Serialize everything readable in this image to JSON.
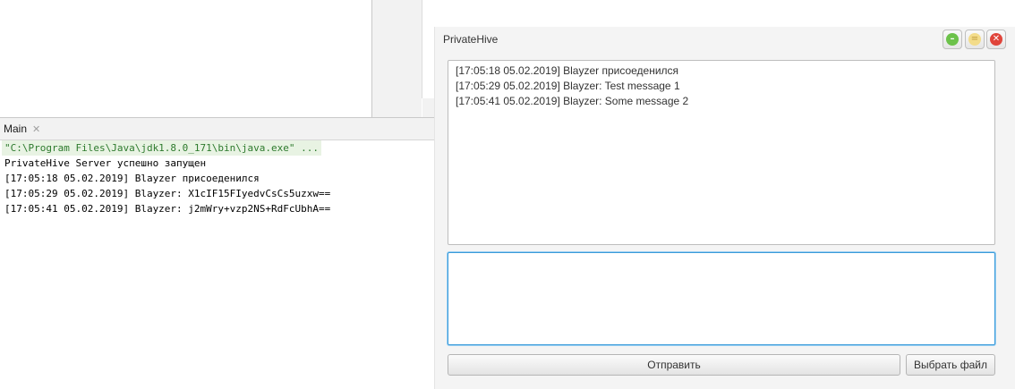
{
  "ide": {
    "run_tab": {
      "label": "Main",
      "close_icon": "close-icon"
    },
    "console": {
      "lines": [
        "\"C:\\Program Files\\Java\\jdk1.8.0_171\\bin\\java.exe\" ...",
        "PrivateHive Server успешно запущен",
        "[17:05:18 05.02.2019] Blayzer присоеденился",
        "[17:05:29 05.02.2019] Blayzer: X1cIF15FIyedvCsCs5uzxw==",
        "[17:05:41 05.02.2019] Blayzer: j2mWry+vzp2NS+RdFcUbhA=="
      ]
    }
  },
  "window": {
    "title": "PrivateHive",
    "controls": {
      "minimize": "minimize-icon",
      "maximize": "maximize-icon",
      "close": "close-icon"
    },
    "messages": [
      "[17:05:18 05.02.2019] Blayzer присоеденился",
      "[17:05:29 05.02.2019] Blayzer: Test message 1",
      "[17:05:41 05.02.2019] Blayzer: Some message 2"
    ],
    "input_value": "",
    "send_label": "Отправить",
    "file_label": "Выбрать файл"
  },
  "colors": {
    "accent_focus": "#3a9ad9",
    "minimize_green": "#6cc24a",
    "close_red": "#e0443a"
  }
}
